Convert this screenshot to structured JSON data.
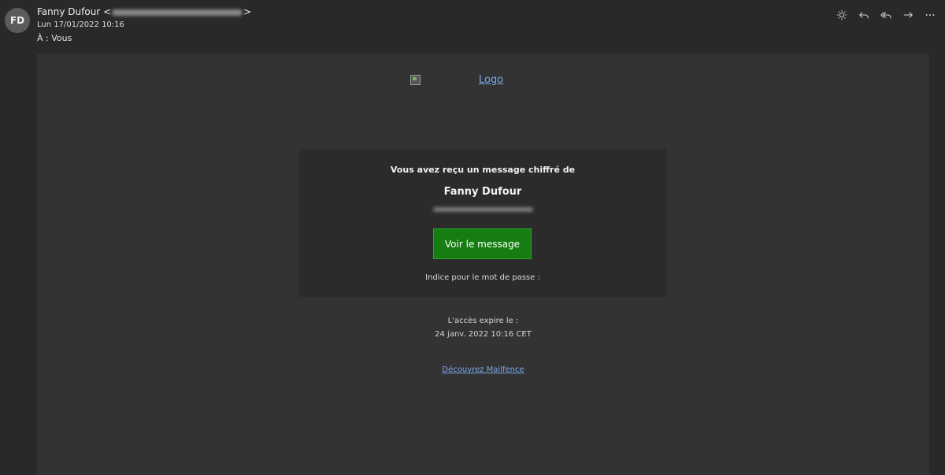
{
  "header": {
    "avatar_initials": "FD",
    "sender_name": "Fanny Dufour",
    "sender_email_open": "<",
    "sender_email_close": ">",
    "date": "Lun 17/01/2022 10:16",
    "to_label": "À :",
    "to_value": "Vous",
    "toolbar": [
      {
        "icon": "sun-icon",
        "label": "brightness"
      },
      {
        "icon": "reply-icon",
        "label": "reply"
      },
      {
        "icon": "reply-all-icon",
        "label": "reply-all"
      },
      {
        "icon": "forward-icon",
        "label": "forward"
      },
      {
        "icon": "more-icon",
        "label": "more"
      }
    ]
  },
  "message": {
    "logo_text": "Logo",
    "title": "Vous avez reçu un message chiffré de",
    "sender_name": "Fanny Dufour",
    "button_label": "Voir le message",
    "hint": "Indice pour le mot de passe :",
    "expire_label": "L'accès expire le :",
    "expire_date": "24 janv. 2022 10:16 CET",
    "discover_link": "Découvrez Mailfence"
  },
  "colors": {
    "background": "#292929",
    "body": "#333333",
    "card": "#2b2b2b",
    "button": "#157d12",
    "link": "#7aa7e8"
  }
}
